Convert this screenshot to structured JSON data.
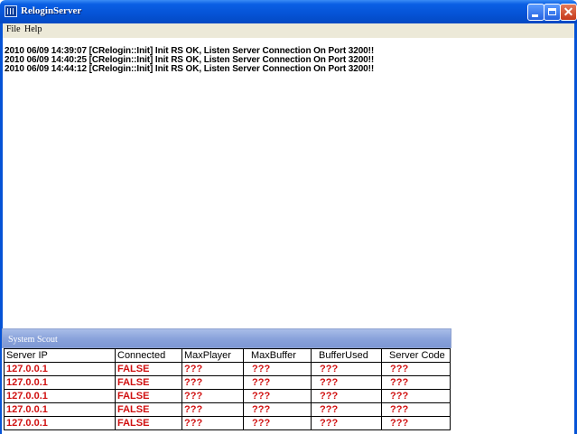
{
  "window": {
    "title": "ReloginServer",
    "icon": "server-app-icon",
    "colors": {
      "titlebar": "#0553d6",
      "close": "#c5391a"
    }
  },
  "menu": {
    "items": [
      {
        "label": "File"
      },
      {
        "label": "Help"
      }
    ]
  },
  "log": {
    "lines": [
      "2010 06/09 14:39:07 [CRelogin::Init] Init RS OK, Listen Server Connection On Port 3200!!",
      "2010 06/09 14:40:25 [CRelogin::Init] Init RS OK, Listen Server Connection On Port 3200!!",
      "2010 06/09 14:44:12 [CRelogin::Init] Init RS OK, Listen Server Connection On Port 3200!!"
    ]
  },
  "scout": {
    "title": "System Scout",
    "columns": [
      "Server IP",
      "Connected",
      "MaxPlayer",
      "MaxBuffer",
      "BufferUsed",
      "Server Code"
    ],
    "rows": [
      [
        "127.0.0.1",
        "FALSE",
        "???",
        "???",
        "???",
        "???"
      ],
      [
        "127.0.0.1",
        "FALSE",
        "???",
        "???",
        "???",
        "???"
      ],
      [
        "127.0.0.1",
        "FALSE",
        "???",
        "???",
        "???",
        "???"
      ],
      [
        "127.0.0.1",
        "FALSE",
        "???",
        "???",
        "???",
        "???"
      ],
      [
        "127.0.0.1",
        "FALSE",
        "???",
        "???",
        "???",
        "???"
      ]
    ],
    "value_color": "#d01010"
  }
}
